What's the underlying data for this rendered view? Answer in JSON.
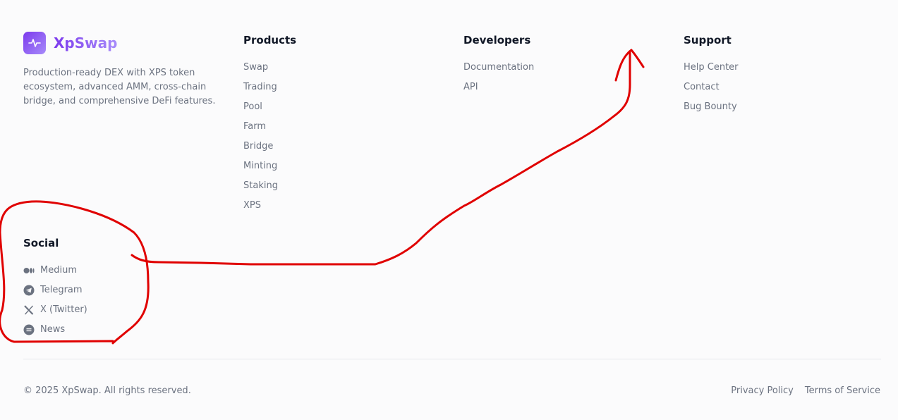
{
  "brand": {
    "name": "XpSwap",
    "description": "Production-ready DEX with XPS token ecosystem, advanced AMM, cross-chain bridge, and comprehensive DeFi features.",
    "logo_icon": "pulse-icon",
    "accent_color": "#7c3aed"
  },
  "products": {
    "title": "Products",
    "items": [
      "Swap",
      "Trading",
      "Pool",
      "Farm",
      "Bridge",
      "Minting",
      "Staking",
      "XPS"
    ]
  },
  "developers": {
    "title": "Developers",
    "items": [
      "Documentation",
      "API"
    ]
  },
  "support": {
    "title": "Support",
    "items": [
      "Help Center",
      "Contact",
      "Bug Bounty"
    ]
  },
  "social": {
    "title": "Social",
    "items": [
      {
        "label": "Medium",
        "icon": "medium-icon"
      },
      {
        "label": "Telegram",
        "icon": "telegram-icon"
      },
      {
        "label": "X (Twitter)",
        "icon": "x-twitter-icon"
      },
      {
        "label": "News",
        "icon": "news-icon"
      }
    ]
  },
  "footer": {
    "copyright": "© 2025 XpSwap. All rights reserved.",
    "privacy": "Privacy Policy",
    "terms": "Terms of Service"
  },
  "annotation": {
    "color": "#e00000",
    "shapes": [
      "circle-around-social",
      "arrow-to-support"
    ]
  }
}
